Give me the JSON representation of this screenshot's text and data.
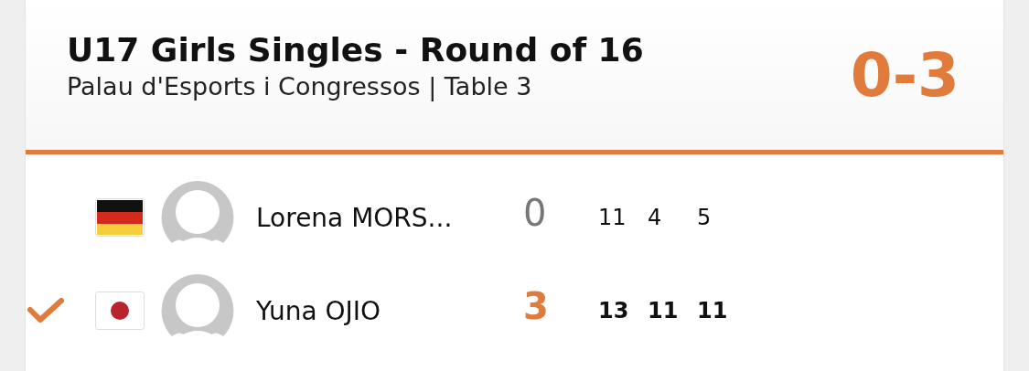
{
  "match": {
    "title": "U17 Girls Singles - Round of 16",
    "subtitle": "Palau d'Esports i Congressos | Table 3",
    "score": "0-3"
  },
  "players": [
    {
      "kind": "de",
      "name": "Lorena MORS...",
      "winner": false,
      "sets": "0",
      "games": [
        "11",
        "4",
        "5"
      ]
    },
    {
      "kind": "jp",
      "name": "Yuna OJIO",
      "winner": true,
      "sets": "3",
      "games": [
        "13",
        "11",
        "11"
      ]
    }
  ]
}
